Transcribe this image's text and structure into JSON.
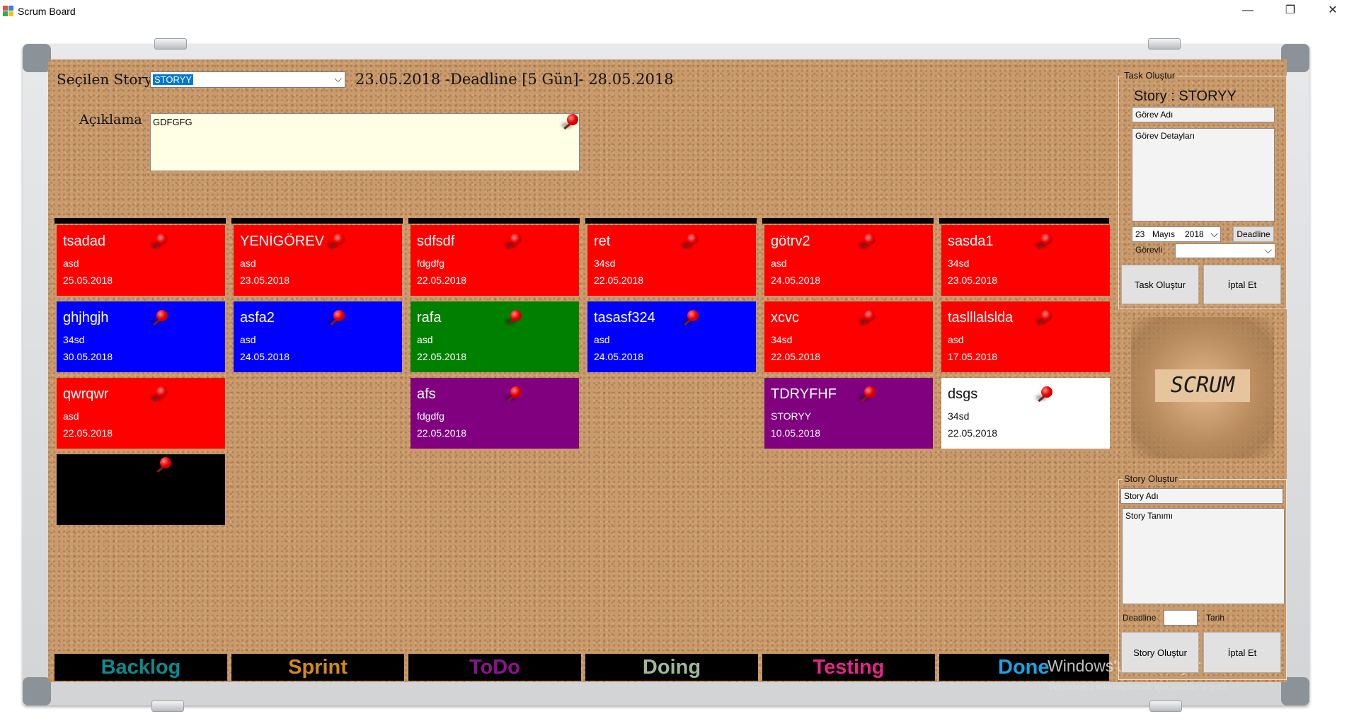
{
  "window": {
    "title": "Scrum Board",
    "controls": {
      "minimize": "—",
      "restore": "❐",
      "close": "✕"
    }
  },
  "story_bar": {
    "label": "Seçilen Story",
    "selected_story": "STORYY",
    "date_range": "23.05.2018 -Deadline [5 Gün]- 28.05.2018"
  },
  "description": {
    "label": "Açıklama",
    "value": "GDFGFG"
  },
  "colors": {
    "red": "#ff0000",
    "blue": "#0000ff",
    "green": "#008000",
    "purple": "#800080",
    "white": "#ffffff",
    "black": "#000000",
    "cork": "#c99a6b"
  },
  "columns": [
    {
      "label": "Backlog",
      "color": "#0f8a8a",
      "cards": [
        {
          "title": "tsadad",
          "detail": "asd",
          "date": "25.05.2018",
          "color": "red"
        },
        {
          "title": "ghjhgjh",
          "detail": "34sd",
          "date": "30.05.2018",
          "color": "blue"
        },
        {
          "title": "qwrqwr",
          "detail": "asd",
          "date": "22.05.2018",
          "color": "red"
        },
        {
          "title": "",
          "detail": "",
          "date": "",
          "color": "black"
        }
      ]
    },
    {
      "label": "Sprint",
      "color": "#d28a1e",
      "cards": [
        {
          "title": "YENİGÖREV",
          "detail": "asd",
          "date": "23.05.2018",
          "color": "red"
        },
        {
          "title": "asfa2",
          "detail": "asd",
          "date": "24.05.2018",
          "color": "blue"
        }
      ]
    },
    {
      "label": "ToDo",
      "color": "#8a158a",
      "cards": [
        {
          "title": "sdfsdf",
          "detail": "fdgdfg",
          "date": "22.05.2018",
          "color": "red"
        },
        {
          "title": "rafa",
          "detail": "asd",
          "date": "22.05.2018",
          "color": "green"
        },
        {
          "title": "afs",
          "detail": "fdgdfg",
          "date": "22.05.2018",
          "color": "purple"
        }
      ]
    },
    {
      "label": "Doing",
      "color": "#9fb89a",
      "cards": [
        {
          "title": "ret",
          "detail": "34sd",
          "date": "22.05.2018",
          "color": "red"
        },
        {
          "title": "tasasf324",
          "detail": "asd",
          "date": "24.05.2018",
          "color": "blue"
        }
      ]
    },
    {
      "label": "Testing",
      "color": "#e8248a",
      "cards": [
        {
          "title": "götrv2",
          "detail": "asd",
          "date": "24.05.2018",
          "color": "red"
        },
        {
          "title": "xcvc",
          "detail": "34sd",
          "date": "22.05.2018",
          "color": "red"
        },
        {
          "title": "TDRYFHF",
          "detail": "STORYY",
          "date": "10.05.2018",
          "color": "purple"
        }
      ]
    },
    {
      "label": "Done",
      "color": "#1aa3e0",
      "cards": [
        {
          "title": "sasda1",
          "detail": "34sd",
          "date": "23.05.2018",
          "color": "red"
        },
        {
          "title": "taslllalslda",
          "detail": "asd",
          "date": "17.05.2018",
          "color": "red"
        },
        {
          "title": "dsgs",
          "detail": "34sd",
          "date": "22.05.2018",
          "color": "white"
        }
      ]
    }
  ],
  "task_panel": {
    "group_title": "Task Oluştur",
    "story_caption": "Story : STORYY",
    "task_name": "Görev Adı",
    "task_details": "Görev Detayları",
    "date_day": "23",
    "date_month": "Mayıs",
    "date_year": "2018",
    "deadline_button": "Deadline",
    "assignee_label": "Görevli",
    "assignee_value": "",
    "create_button": "Task Oluştur",
    "cancel_button": "İptal Et"
  },
  "scrum_logo": "SCRUM",
  "story_panel": {
    "group_title": "Story Oluştur",
    "story_name": "Story Adı",
    "story_desc": "Story Tanımı",
    "deadline_label": "Deadline",
    "deadline_value": "",
    "date_label": "Tarih",
    "create_button": "Story Oluştur",
    "cancel_button": "İptal Et"
  },
  "watermark": {
    "line1": "Windows'u Etkinleştir",
    "line2": "Windows'u etkinleştirmek için Ayarlar'a gidin"
  }
}
